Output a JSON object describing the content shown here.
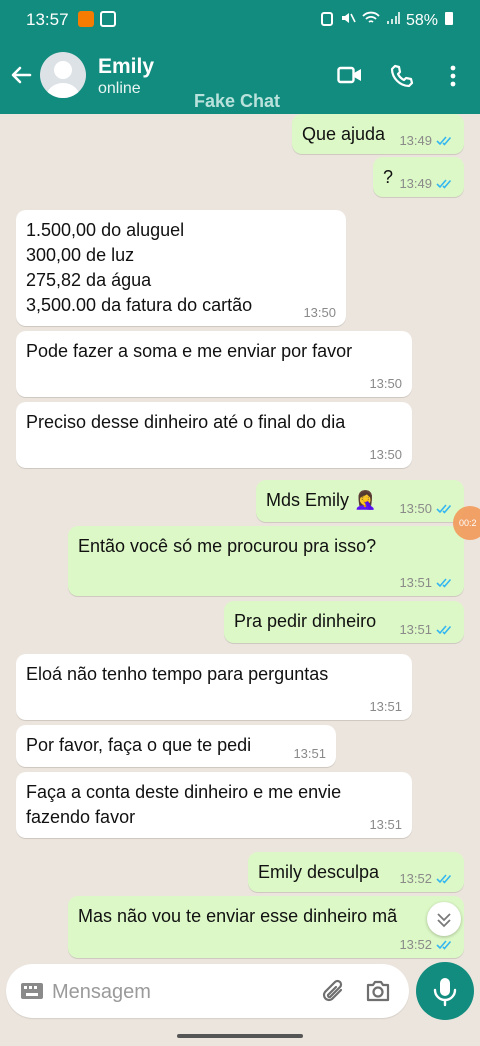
{
  "status_bar": {
    "time": "13:57",
    "battery": "58%"
  },
  "header": {
    "contact_name": "Emily",
    "contact_status": "online",
    "watermark": "Fake Chat"
  },
  "messages": [
    {
      "dir": "out",
      "text": "Que ajuda",
      "time": "13:49"
    },
    {
      "dir": "out",
      "text": "?",
      "time": "13:49"
    },
    {
      "dir": "in",
      "text": "1.500,00 do aluguel\n300,00 de luz\n275,82 da água\n3,500.00 da fatura do cartão",
      "time": "13:50"
    },
    {
      "dir": "in",
      "text": "Pode fazer a soma e me enviar por favor",
      "time": "13:50"
    },
    {
      "dir": "in",
      "text": "Preciso desse dinheiro até o final do dia",
      "time": "13:50"
    },
    {
      "dir": "out",
      "text": "Mds Emily 🤦‍♀️",
      "time": "13:50"
    },
    {
      "dir": "out",
      "text": "Então você só me procurou pra isso?",
      "time": "13:51"
    },
    {
      "dir": "out",
      "text": "Pra pedir dinheiro",
      "time": "13:51"
    },
    {
      "dir": "in",
      "text": "Eloá não tenho tempo para perguntas",
      "time": "13:51"
    },
    {
      "dir": "in",
      "text": "Por favor, faça o que te pedi",
      "time": "13:51"
    },
    {
      "dir": "in",
      "text": "Faça a conta deste dinheiro e me envie\nfazendo favor",
      "time": "13:51"
    },
    {
      "dir": "out",
      "text": "Emily desculpa",
      "time": "13:52"
    },
    {
      "dir": "out",
      "text": "Mas não vou te enviar esse dinheiro mã",
      "time": "13:52"
    }
  ],
  "overlay_badge": "00:2",
  "composer": {
    "placeholder": "Mensagem"
  },
  "colors": {
    "header": "#128C7E",
    "chat_bg": "#ECE5DD",
    "outgoing": "#DCF8C6",
    "incoming": "#FFFFFF",
    "read_ticks": "#34B7F1"
  },
  "icons": [
    "back-arrow-icon",
    "video-call-icon",
    "phone-icon",
    "more-vert-icon",
    "keyboard-icon",
    "attach-icon",
    "camera-icon",
    "mic-icon",
    "scroll-down-icon"
  ]
}
